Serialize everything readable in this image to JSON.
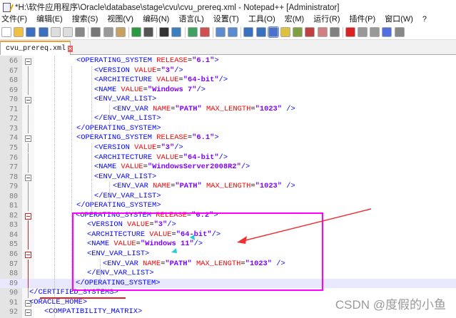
{
  "window": {
    "title": "*H:\\软件应用程序\\Oracle\\database\\stage\\cvu\\cvu_prereq.xml - Notepad++ [Administrator]"
  },
  "menu": [
    "文件(F)",
    "编辑(E)",
    "搜索(S)",
    "视图(V)",
    "编码(N)",
    "语言(L)",
    "设置(T)",
    "工具(O)",
    "宏(M)",
    "运行(R)",
    "插件(P)",
    "窗口(W)",
    "?"
  ],
  "toolbar": [
    "new-file",
    "open-file",
    "save",
    "save-all",
    "close",
    "close-all",
    "print",
    "cut",
    "copy",
    "paste",
    "undo",
    "redo",
    "find",
    "replace",
    "zoom-in",
    "zoom-out",
    "sync-v",
    "sync-h",
    "word-wrap",
    "show-all-chars",
    "indent-guide",
    "udl",
    "doc-map",
    "function-list",
    "folder-workspace",
    "monitor",
    "record-macro",
    "stop-record",
    "play-macro",
    "run-macro-multiple",
    "save-macro"
  ],
  "tab": {
    "label": "cvu_prereq.xml"
  },
  "lines": [
    {
      "n": "66",
      "tok": [
        [
          "t",
          "<OPERATING_SYSTEM "
        ],
        [
          "a",
          "RELEASE"
        ],
        [
          "o",
          "="
        ],
        [
          "v",
          "\"6.1\""
        ],
        [
          "t",
          ">"
        ]
      ]
    },
    {
      "n": "67",
      "tok": [
        [
          "t",
          "<VERSION "
        ],
        [
          "a",
          "VALUE"
        ],
        [
          "o",
          "="
        ],
        [
          "v",
          "\"3\""
        ],
        [
          "t",
          "/>"
        ]
      ]
    },
    {
      "n": "68",
      "tok": [
        [
          "t",
          "<ARCHITECTURE "
        ],
        [
          "a",
          "VALUE"
        ],
        [
          "o",
          "="
        ],
        [
          "v",
          "\"64-bit\""
        ],
        [
          "t",
          "/>"
        ]
      ]
    },
    {
      "n": "69",
      "tok": [
        [
          "t",
          "<NAME "
        ],
        [
          "a",
          "VALUE"
        ],
        [
          "o",
          "="
        ],
        [
          "v",
          "\"Windows 7\""
        ],
        [
          "t",
          "/>"
        ]
      ]
    },
    {
      "n": "70",
      "tok": [
        [
          "t",
          "<ENV_VAR_LIST>"
        ]
      ]
    },
    {
      "n": "71",
      "tok": [
        [
          "t",
          "<ENV_VAR "
        ],
        [
          "a",
          "NAME"
        ],
        [
          "o",
          "="
        ],
        [
          "v",
          "\"PATH\""
        ],
        [
          "t",
          " "
        ],
        [
          "a",
          "MAX_LENGTH"
        ],
        [
          "o",
          "="
        ],
        [
          "v",
          "\"1023\""
        ],
        [
          "t",
          " />"
        ]
      ]
    },
    {
      "n": "72",
      "tok": [
        [
          "t",
          "</ENV_VAR_LIST>"
        ]
      ]
    },
    {
      "n": "73",
      "tok": [
        [
          "t",
          "</OPERATING_SYSTEM>"
        ]
      ]
    },
    {
      "n": "74",
      "tok": [
        [
          "t",
          "<OPERATING_SYSTEM "
        ],
        [
          "a",
          "RELEASE"
        ],
        [
          "o",
          "="
        ],
        [
          "v",
          "\"6.1\""
        ],
        [
          "t",
          ">"
        ]
      ]
    },
    {
      "n": "75",
      "tok": [
        [
          "t",
          "<VERSION "
        ],
        [
          "a",
          "VALUE"
        ],
        [
          "o",
          "="
        ],
        [
          "v",
          "\"3\""
        ],
        [
          "t",
          "/>"
        ]
      ]
    },
    {
      "n": "76",
      "tok": [
        [
          "t",
          "<ARCHITECTURE "
        ],
        [
          "a",
          "VALUE"
        ],
        [
          "o",
          "="
        ],
        [
          "v",
          "\"64-bit\""
        ],
        [
          "t",
          "/>"
        ]
      ]
    },
    {
      "n": "77",
      "tok": [
        [
          "t",
          "<NAME "
        ],
        [
          "a",
          "VALUE"
        ],
        [
          "o",
          "="
        ],
        [
          "v",
          "\"WindowsServer2008R2\""
        ],
        [
          "t",
          "/>"
        ]
      ]
    },
    {
      "n": "78",
      "tok": [
        [
          "t",
          "<ENV_VAR_LIST>"
        ]
      ]
    },
    {
      "n": "79",
      "tok": [
        [
          "t",
          "<ENV_VAR "
        ],
        [
          "a",
          "NAME"
        ],
        [
          "o",
          "="
        ],
        [
          "v",
          "\"PATH\""
        ],
        [
          "t",
          " "
        ],
        [
          "a",
          "MAX_LENGTH"
        ],
        [
          "o",
          "="
        ],
        [
          "v",
          "\"1023\""
        ],
        [
          "t",
          " />"
        ]
      ]
    },
    {
      "n": "80",
      "tok": [
        [
          "t",
          "</ENV_VAR_LIST>"
        ]
      ]
    },
    {
      "n": "81",
      "tok": [
        [
          "t",
          "</OPERATING_SYSTEM>"
        ]
      ]
    },
    {
      "n": "82",
      "tok": [
        [
          "t",
          "<OPERATING_SYSTEM "
        ],
        [
          "a",
          "RELEASE"
        ],
        [
          "o",
          "="
        ],
        [
          "v",
          "\"6.2\""
        ],
        [
          "t",
          ">"
        ]
      ]
    },
    {
      "n": "83",
      "tok": [
        [
          "t",
          "<VERSION "
        ],
        [
          "a",
          "VALUE"
        ],
        [
          "o",
          "="
        ],
        [
          "v",
          "\"3\""
        ],
        [
          "t",
          "/>"
        ]
      ]
    },
    {
      "n": "84",
      "tok": [
        [
          "t",
          "<ARCHITECTURE "
        ],
        [
          "a",
          "VALUE"
        ],
        [
          "o",
          "="
        ],
        [
          "v",
          "\"64-bit\""
        ],
        [
          "t",
          "/>"
        ]
      ]
    },
    {
      "n": "85",
      "tok": [
        [
          "t",
          "<NAME "
        ],
        [
          "a",
          "VALUE"
        ],
        [
          "o",
          "="
        ],
        [
          "v",
          "\"Windows 11\""
        ],
        [
          "t",
          "/>"
        ]
      ]
    },
    {
      "n": "86",
      "tok": [
        [
          "t",
          "<ENV_VAR_LIST>"
        ]
      ]
    },
    {
      "n": "87",
      "tok": [
        [
          "t",
          "<ENV_VAR "
        ],
        [
          "a",
          "NAME"
        ],
        [
          "o",
          "="
        ],
        [
          "v",
          "\"PATH\""
        ],
        [
          "t",
          " "
        ],
        [
          "a",
          "MAX_LENGTH"
        ],
        [
          "o",
          "="
        ],
        [
          "v",
          "\"1023\""
        ],
        [
          "t",
          " />"
        ]
      ]
    },
    {
      "n": "88",
      "tok": [
        [
          "t",
          "</ENV_VAR_LIST>"
        ]
      ]
    },
    {
      "n": "89",
      "tok": [
        [
          "t",
          "</OPERATING_SYSTEM>"
        ]
      ]
    },
    {
      "n": "90",
      "tok": [
        [
          "t",
          "</CERTIFIED_SYSTEMS>"
        ]
      ]
    },
    {
      "n": "91",
      "tok": [
        [
          "t",
          "<ORACLE_HOME>"
        ]
      ]
    },
    {
      "n": "92",
      "tok": [
        [
          "t",
          "<COMPATIBILITY_MATRIX>"
        ]
      ]
    }
  ],
  "watermark": "CSDN @度假的小鱼",
  "colors": {
    "tag": "#0000ff",
    "attr": "#ff0000",
    "value": "#8000ff",
    "highlight_box": "#ff00ff",
    "arrow": "#f03030"
  }
}
